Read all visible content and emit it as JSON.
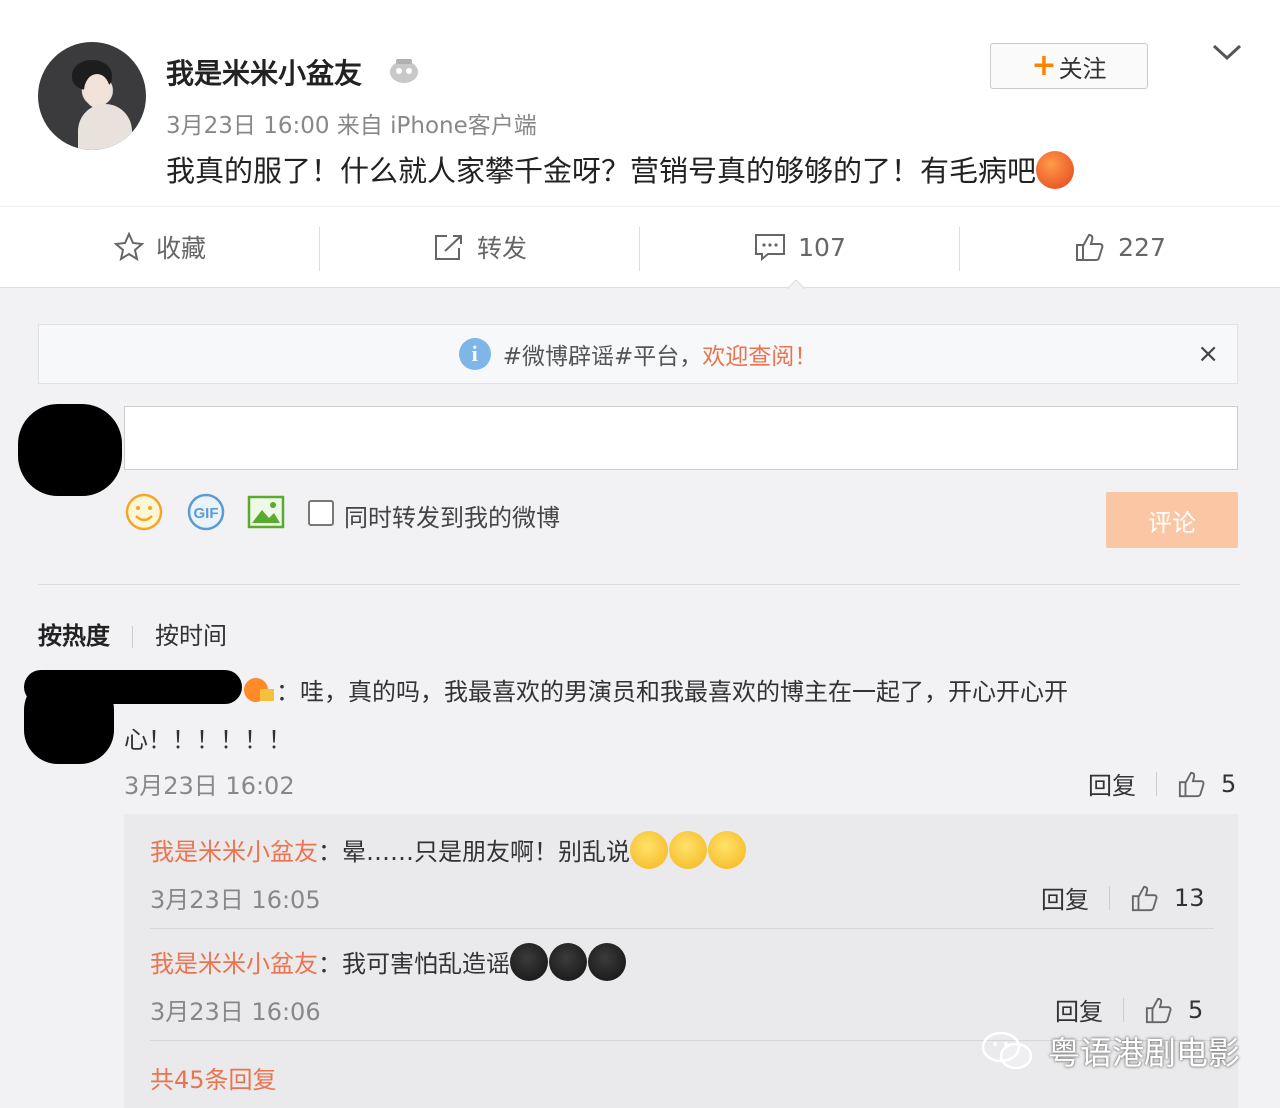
{
  "post": {
    "username": "我是米米小盆友",
    "meta": "3月23日 16:00 来自 iPhone客户端",
    "content": "我真的服了！什么就人家攀千金呀？营销号真的够够的了！有毛病吧",
    "follow_label": "关注",
    "follow_plus": "+"
  },
  "actions": {
    "favorite": "收藏",
    "repost": "转发",
    "comments": "107",
    "likes": "227"
  },
  "notice": {
    "info_glyph": "i",
    "text": "#微博辟谣#平台，",
    "link": "欢迎查阅！",
    "close": "×"
  },
  "composer": {
    "checkbox_label": "同时转发到我的微博",
    "submit": "评论"
  },
  "sort": {
    "hot": "按热度",
    "time": "按时间"
  },
  "comment": {
    "text_line1": "：哇，真的吗，我最喜欢的男演员和我最喜欢的博主在一起了，开心开心开",
    "text_line2": "心！！！！！！",
    "time": "3月23日 16:02",
    "reply": "回复",
    "likes": "5"
  },
  "replies": [
    {
      "author": "我是米米小盆友",
      "text": "：晕……只是朋友啊！别乱说",
      "time": "3月23日 16:05",
      "reply": "回复",
      "likes": "13"
    },
    {
      "author": "我是米米小盆友",
      "text": "：我可害怕乱造谣",
      "time": "3月23日 16:06",
      "reply": "回复",
      "likes": "5"
    }
  ],
  "more_replies": "共45条回复",
  "watermark": "粤语港剧电影",
  "colors": {
    "accent": "#eb7350",
    "follow_plus": "#ff8200",
    "submit_disabled": "#fac6a4"
  },
  "icons": [
    "star-icon",
    "repost-icon",
    "comment-icon",
    "thumbs-up-icon",
    "info-icon",
    "close-icon",
    "smile-icon",
    "gif-icon",
    "image-icon",
    "chevron-down-icon",
    "vip-icon",
    "wechat-icon"
  ]
}
